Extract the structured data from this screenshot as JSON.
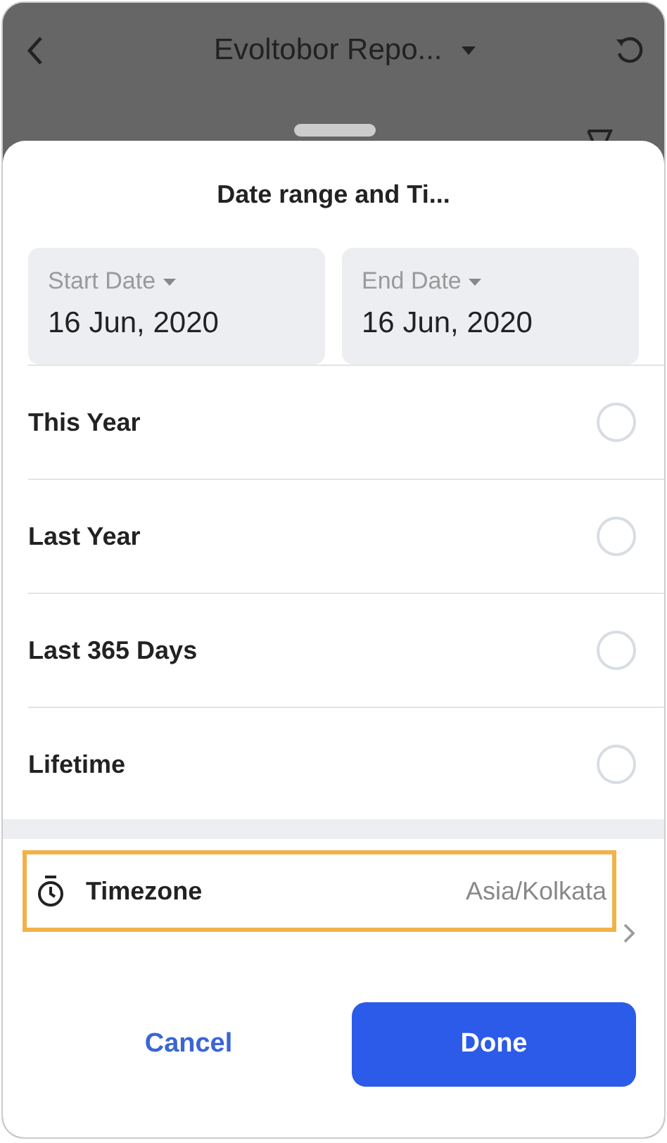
{
  "header": {
    "title": "Evoltobor Repo..."
  },
  "sheet": {
    "title": "Date range and Ti...",
    "dates": [
      {
        "label": "Start Date",
        "value": "16 Jun, 2020"
      },
      {
        "label": "End Date",
        "value": "16 Jun, 2020"
      }
    ],
    "options": [
      {
        "label": "This Year",
        "selected": false
      },
      {
        "label": "Last Year",
        "selected": false
      },
      {
        "label": "Last 365 Days",
        "selected": false
      },
      {
        "label": "Lifetime",
        "selected": false
      }
    ],
    "timezone": {
      "label": "Timezone",
      "value": "Asia/Kolkata",
      "highlighted": true
    },
    "buttons": [
      {
        "label": "Cancel",
        "kind": "text"
      },
      {
        "label": "Done",
        "kind": "primary"
      }
    ]
  }
}
